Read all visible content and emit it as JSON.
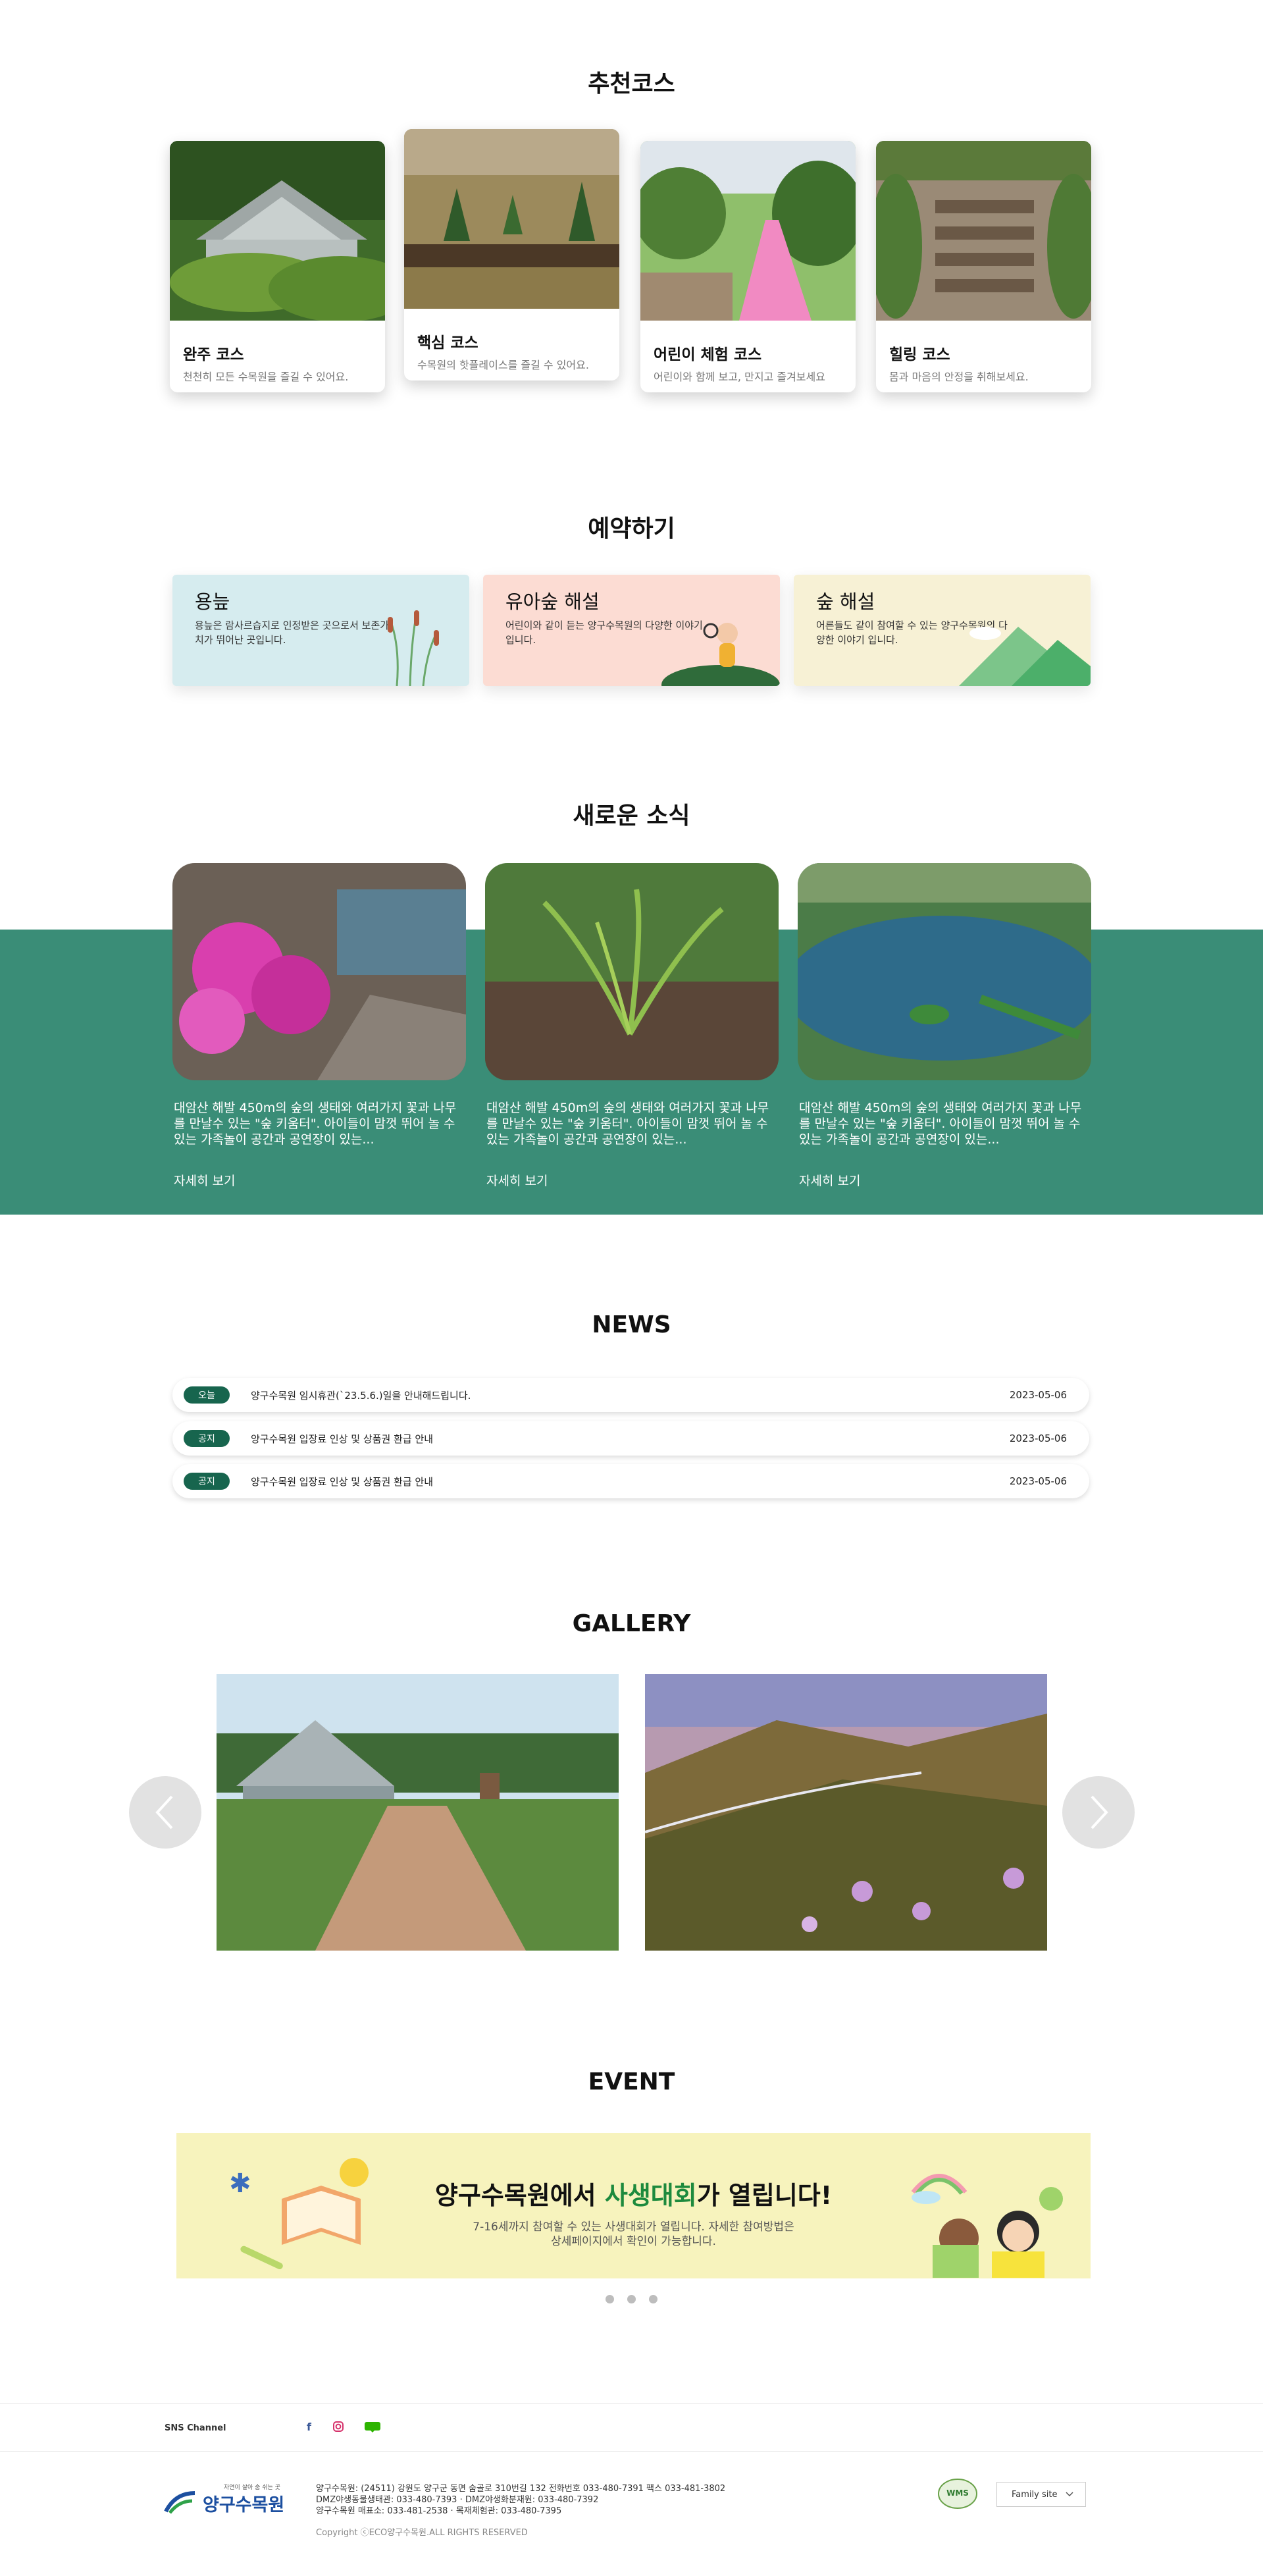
{
  "recommend": {
    "title": "추천코스",
    "courses": [
      {
        "title": "완주 코스",
        "desc": "천천히 모든 수목원을 즐길 수 있어요."
      },
      {
        "title": "핵심 코스",
        "desc": "수목원의 핫플레이스를 즐길 수 있어요."
      },
      {
        "title": "어린이 체험 코스",
        "desc": "어린이와 함께 보고, 만지고 즐겨보세요"
      },
      {
        "title": "힐링 코스",
        "desc": "몸과 마음의 안정을 취해보세요."
      }
    ]
  },
  "reserve": {
    "title": "예약하기",
    "items": [
      {
        "title": "용늪",
        "desc": "용늪은 람사르습지로 인정받은 곳으로서 보존가치가 뛰어난 곳입니다.",
        "bg": "#d6ecef"
      },
      {
        "title": "유아숲 해설",
        "desc": "어린이와 같이 듣는 양구수목원의 다양한 이야기 입니다.",
        "bg": "#fcdcd3"
      },
      {
        "title": "숲 해설",
        "desc": "어른들도 같이 참여할 수 있는 양구수목원의 다양한 이야기 입니다.",
        "bg": "#f7f1d5"
      }
    ]
  },
  "latest": {
    "title": "새로운 소식",
    "more_label": "자세히 보기",
    "band_color": "#3a8d77",
    "cards": [
      {
        "text": "대암산 해발 450m의 숲의 생태와 여러가지 꽃과 나무를 만날수 있는 \"숲 키움터\". 아이들이 맘껏 뛰어 놀 수 있는 가족놀이 공간과 공연장이 있는..."
      },
      {
        "text": "대암산 해발 450m의 숲의 생태와 여러가지 꽃과 나무를 만날수 있는 \"숲 키움터\". 아이들이 맘껏 뛰어 놀 수 있는 가족놀이 공간과 공연장이 있는..."
      },
      {
        "text": "대암산 해발 450m의 숲의 생태와 여러가지 꽃과 나무를 만날수 있는 \"숲 키움터\". 아이들이 맘껏 뛰어 놀 수 있는 가족놀이 공간과 공연장이 있는..."
      }
    ]
  },
  "news": {
    "title": "NEWS",
    "rows": [
      {
        "badge": "오늘",
        "text": "양구수목원 임시휴관(`23.5.6.)일을 안내해드립니다.",
        "date": "2023-05-06"
      },
      {
        "badge": "공지",
        "text": "양구수목원 입장료 인상 및 상품권 환급 안내",
        "date": "2023-05-06"
      },
      {
        "badge": "공지",
        "text": "양구수목원 입장료 인상 및 상품권 환급 안내",
        "date": "2023-05-06"
      }
    ]
  },
  "gallery": {
    "title": "GALLERY"
  },
  "event": {
    "title": "EVENT",
    "banner_pre": "양구수목원에서 ",
    "banner_hl": "사생대회",
    "banner_post": "가 열립니다!",
    "banner_desc1": "7-16세까지 참여할 수 있는 사생대회가 열립니다. 자세한 참여방법은",
    "banner_desc2": "상세페이지에서 확인이 가능합니다."
  },
  "footer": {
    "sns_label": "SNS Channel",
    "logo_tagline": "자연이 살아 숨 쉬는 곳",
    "logo_name": "양구수목원",
    "address1": "양구수목원: (24511) 강원도 양구군 동면 숨골로 310번길 132 전화번호 033-480-7391 팩스 033-481-3802",
    "address2": "DMZ야생동물생태관: 033-480-7393 · DMZ야생화분재원: 033-480-7392",
    "address3": "양구수목원 매표소: 033-481-2538 · 목재체험관: 033-480-7395",
    "copyright": "Copyright ⓒECO양구수목원.ALL RIGHTS RESERVED",
    "family_site": "Family site",
    "wms_label": "WMS"
  }
}
